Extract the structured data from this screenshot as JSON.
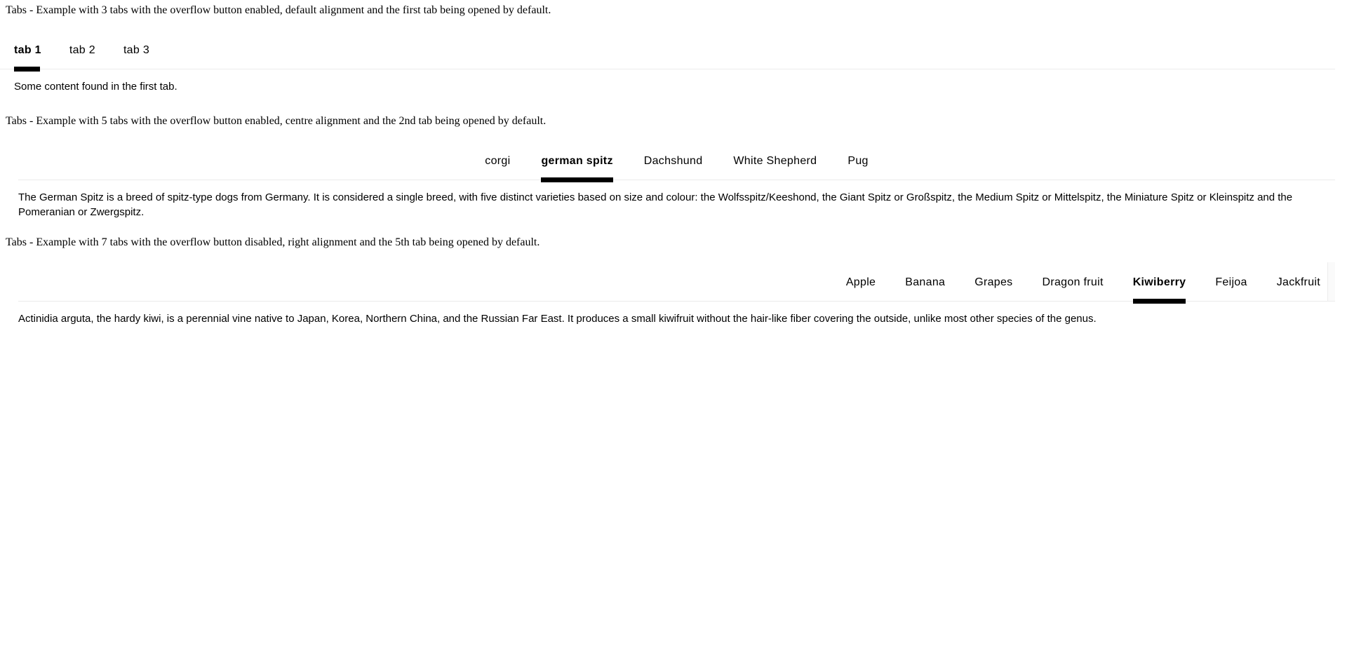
{
  "sections": [
    {
      "description": "Tabs - Example with 3 tabs with the overflow button enabled, default alignment and the first tab being opened by default.",
      "alignment": "default",
      "overflow_button": "enabled",
      "tabs": [
        {
          "label": "tab 1",
          "active": true
        },
        {
          "label": "tab 2",
          "active": false
        },
        {
          "label": "tab 3",
          "active": false
        }
      ],
      "panel_text": "Some content found in the first tab."
    },
    {
      "description": "Tabs - Example with 5 tabs with the overflow button enabled, centre alignment and the 2nd tab being opened by default.",
      "alignment": "centre",
      "overflow_button": "enabled",
      "tabs": [
        {
          "label": "corgi",
          "active": false
        },
        {
          "label": "german spitz",
          "active": true
        },
        {
          "label": "Dachshund",
          "active": false
        },
        {
          "label": "White Shepherd",
          "active": false
        },
        {
          "label": "Pug",
          "active": false
        }
      ],
      "panel_text": "The German Spitz is a breed of spitz-type dogs from Germany. It is considered a single breed, with five distinct varieties based on size and colour: the Wolfsspitz/Keeshond, the Giant Spitz or Großspitz, the Medium Spitz or Mittelspitz, the Miniature Spitz or Kleinspitz and the Pomeranian or Zwergspitz."
    },
    {
      "description": "Tabs - Example with 7 tabs with the overflow button disabled, right alignment and the 5th tab being opened by default.",
      "alignment": "right",
      "overflow_button": "disabled",
      "tabs": [
        {
          "label": "Apple",
          "active": false
        },
        {
          "label": "Banana",
          "active": false
        },
        {
          "label": "Grapes",
          "active": false
        },
        {
          "label": "Dragon fruit",
          "active": false
        },
        {
          "label": "Kiwiberry",
          "active": true
        },
        {
          "label": "Feijoa",
          "active": false
        },
        {
          "label": "Jackfruit",
          "active": false
        }
      ],
      "panel_text": "Actinidia arguta, the hardy kiwi, is a perennial vine native to Japan, Korea, Northern China, and the Russian Far East. It produces a small kiwifruit without the hair-like fiber covering the outside, unlike most other species of the genus."
    }
  ],
  "colors": {
    "active_indicator": "#000000",
    "tablist_border": "#ebebeb",
    "text": "#000000",
    "overflow_edge_fill": "#fafafa",
    "background": "#ffffff"
  }
}
